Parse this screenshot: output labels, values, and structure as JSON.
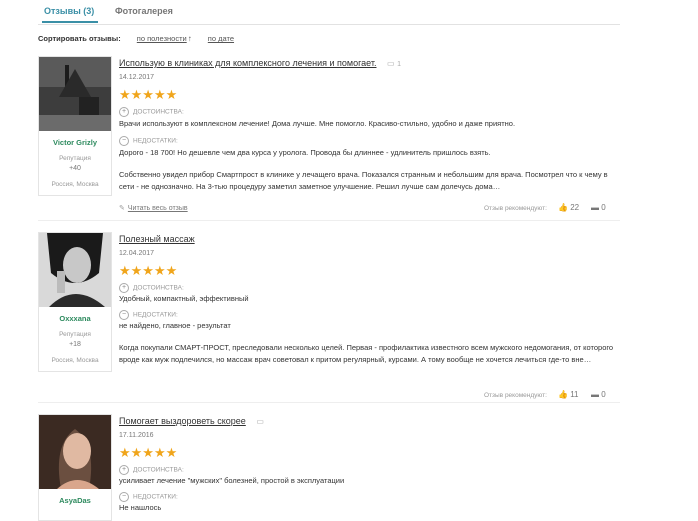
{
  "tabs": {
    "reviews": "Отзывы (3)",
    "gallery": "Фотогалерея"
  },
  "sort": {
    "label": "Сортировать отзывы:",
    "by_usefulness": "по полезности",
    "by_date": "по дате",
    "arrow": "↑"
  },
  "common": {
    "pros_label": "ДОСТОИНСТВА:",
    "cons_label": "НЕДОСТАТКИ:",
    "read_all": "Читать весь отзыв",
    "recommend_label": "Отзыв рекомендуют:",
    "rep_label": "Репутация"
  },
  "reviews": [
    {
      "user": "Victor Grizly",
      "reputation": "+40",
      "location": "Россия, Москва",
      "title": "Использую в клиниках для комплексного лечения и помогает.",
      "photos": "1",
      "date": "14.12.2017",
      "pros": "Врачи используют в комплексном лечение! Дома лучше. Мне помогло. Красиво-стильно, удобно и даже приятно.",
      "cons": "Дорого - 18 700! Но дешевле чем два курса у уролога. Провода бы длиннее - удлинитель пришлось взять.",
      "body": "Собственно увидел прибор Смартпрост в клинике у лечащего врача. Показался странным и небольшим для врача. Посмотрел что к чему в сети - не однозначно. На 3-тью процедуру заметил заметное улучшение. Решил лучше сам долечусь дома…",
      "likes": "22",
      "comments": "0"
    },
    {
      "user": "Oxxxana",
      "reputation": "+18",
      "location": "Россия, Москва",
      "title": "Полезный массаж",
      "photos": "",
      "date": "12.04.2017",
      "pros": "Удобный, компактный, эффективный",
      "cons": "не найдено, главное - результат",
      "body": "Когда покупали СМАРТ-ПРОСТ, преследовали несколько целей. Первая - профилактика известного всем мужского недомогания, от которого вроде как муж подлечился, но массаж врач советовал к притом регулярный, курсами. А тому вообще не хочется лечиться где-то вне…",
      "likes": "11",
      "comments": "0"
    },
    {
      "user": "AsyaDas",
      "reputation": "",
      "location": "",
      "title": "Помогает выздороветь скорее",
      "photos": "",
      "date": "17.11.2016",
      "pros": "усиливает лечение \"мужских\" болезней, простой в эксплуатации",
      "cons": "Не нашлось",
      "body": "",
      "likes": "",
      "comments": ""
    }
  ],
  "colors": {
    "accent": "#3a8fa6",
    "username": "#2d8a5e",
    "star": "#f0a51b"
  }
}
